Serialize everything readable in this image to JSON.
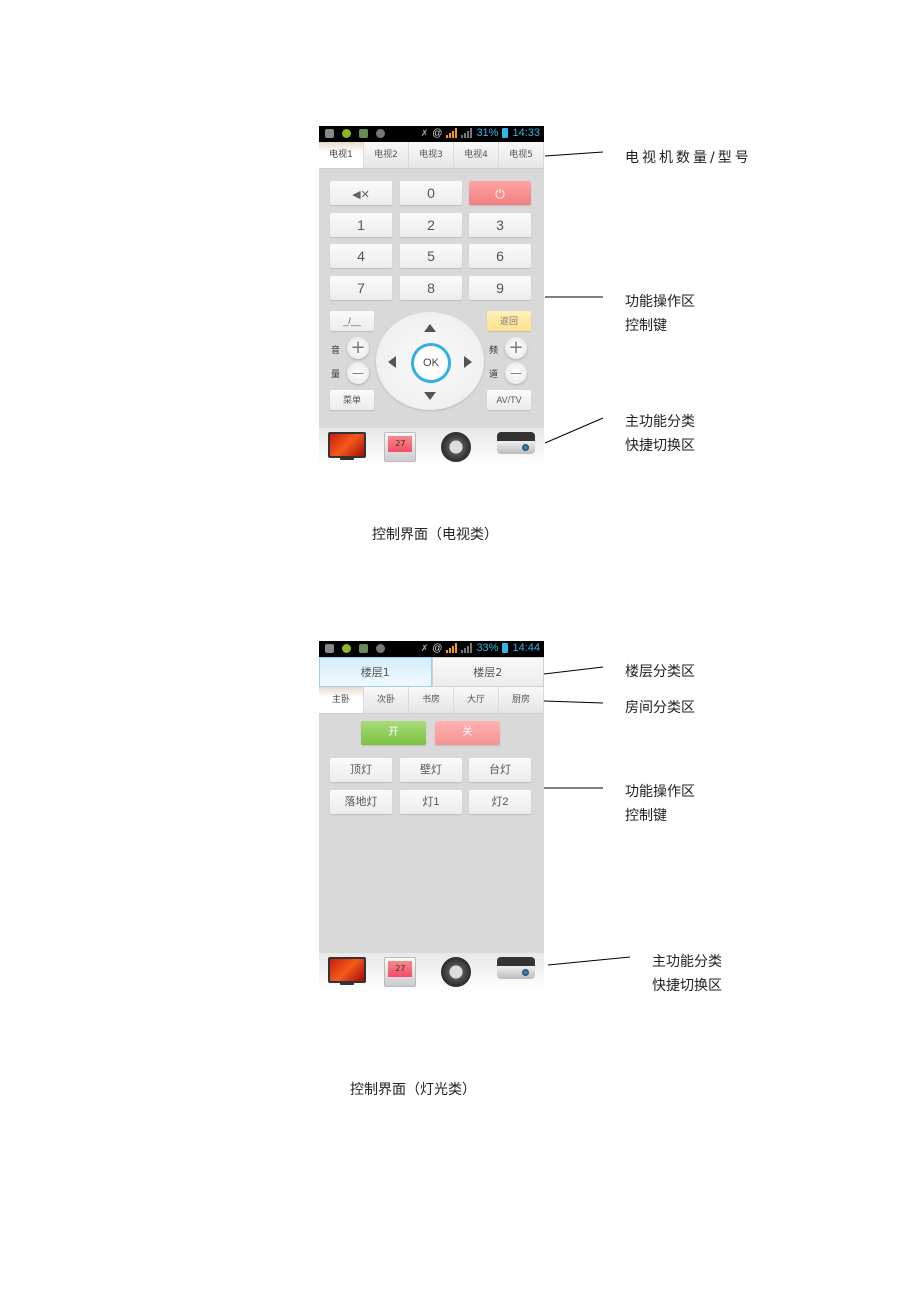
{
  "screen1": {
    "status": {
      "battery": "31%",
      "time": "14:33"
    },
    "tabs": [
      "电视1",
      "电视2",
      "电视3",
      "电视4",
      "电视5"
    ],
    "active_tab": 0,
    "keypad": {
      "mute_icon": "mute-icon",
      "power_icon": "power-icon",
      "keys": [
        "0",
        "1",
        "2",
        "3",
        "4",
        "5",
        "6",
        "7",
        "8",
        "9"
      ]
    },
    "controls": {
      "dash": "_/__",
      "back": "返回",
      "volume_label_top": "音",
      "volume_label_bottom": "量",
      "channel_label_top": "频",
      "channel_label_bottom": "道",
      "ok": "OK",
      "menu": "菜单",
      "avtv": "AV/TV",
      "plus": "+",
      "minus": "—"
    },
    "dock": [
      "tv-icon",
      "thermostat-icon",
      "fan-icon",
      "projector-icon"
    ],
    "thermostat_reading": "27",
    "annotations": {
      "tabs": "电视机数量/型号",
      "controls_line1": "功能操作区",
      "controls_line2": "控制键",
      "dock_line1": "主功能分类",
      "dock_line2": "快捷切换区"
    },
    "caption": "控制界面（电视类）"
  },
  "screen2": {
    "status": {
      "battery": "33%",
      "time": "14:44"
    },
    "floors": [
      "楼层1",
      "楼层2"
    ],
    "active_floor": 0,
    "rooms": [
      "主卧",
      "次卧",
      "书房",
      "大厅",
      "厨房"
    ],
    "active_room": 0,
    "on": "开",
    "off": "关",
    "lights": [
      "顶灯",
      "壁灯",
      "台灯",
      "落地灯",
      "灯1",
      "灯2"
    ],
    "thermostat_reading": "27",
    "annotations": {
      "floors": "楼层分类区",
      "rooms": "房间分类区",
      "controls_line1": "功能操作区",
      "controls_line2": "控制键",
      "dock_line1": "主功能分类",
      "dock_line2": "快捷切换区"
    },
    "caption": "控制界面（灯光类）"
  }
}
